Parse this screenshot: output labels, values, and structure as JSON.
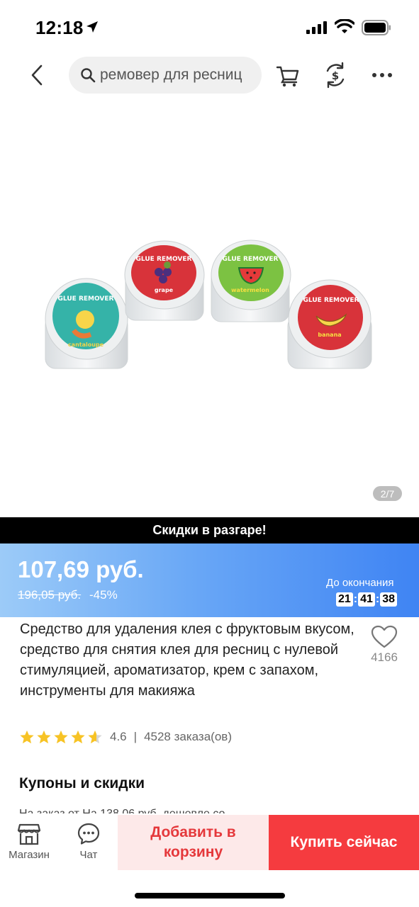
{
  "status_bar": {
    "time": "12:18"
  },
  "search": {
    "query": "ремовер для ресниц"
  },
  "icons": {
    "back": "chevron-left-icon",
    "search": "search-icon",
    "cart": "cart-icon",
    "coin": "currency-exchange-icon",
    "more": "more-icon",
    "wishlist": "heart-icon",
    "shop": "store-icon",
    "chat": "chat-icon"
  },
  "gallery": {
    "counter": "2/7"
  },
  "product_image": {
    "jars": [
      {
        "label_top": "GLUE REMOVER",
        "flavor": "cantaloupe",
        "color": "#35b3a8"
      },
      {
        "label_top": "GLUE REMOVER",
        "flavor": "grape",
        "color": "#d8333a"
      },
      {
        "label_top": "GLUE REMOVER",
        "flavor": "watermelon",
        "color": "#7cc242"
      },
      {
        "label_top": "GLUE REMOVER",
        "flavor": "banana",
        "color": "#d8333a"
      }
    ]
  },
  "promo": {
    "text": "Скидки в разгаре!"
  },
  "price": {
    "current": "107,69 руб.",
    "old": "196,05 руб.",
    "discount": "-45%",
    "countdown_label": "До окончания",
    "countdown": {
      "hours": "21",
      "minutes": "41",
      "seconds": "38"
    }
  },
  "product": {
    "title": "Средство для удаления клея с фруктовым вкусом, средство для снятия клея для ресниц с нулевой стимуляцией, ароматизатор, крем с запахом, инструменты для макияжа",
    "wishlist_count": "4166",
    "rating": 4.6,
    "rating_text": "4.6",
    "rating_separator": "|",
    "orders": "4528 заказа(ов)"
  },
  "coupons": {
    "title": "Купоны и скидки",
    "line": "На заказ от На 138,06 руб. дешевле со"
  },
  "bottom_bar": {
    "shop_label": "Магазин",
    "chat_label": "Чат",
    "add_to_cart": "Добавить в корзину",
    "buy_now": "Купить сейчас"
  },
  "colors": {
    "accent_red": "#f53b3f",
    "add_cart_bg": "#fde9e9",
    "price_gradient_start": "#9ccbf8",
    "price_gradient_end": "#3f84f3",
    "star": "#f7c325"
  }
}
